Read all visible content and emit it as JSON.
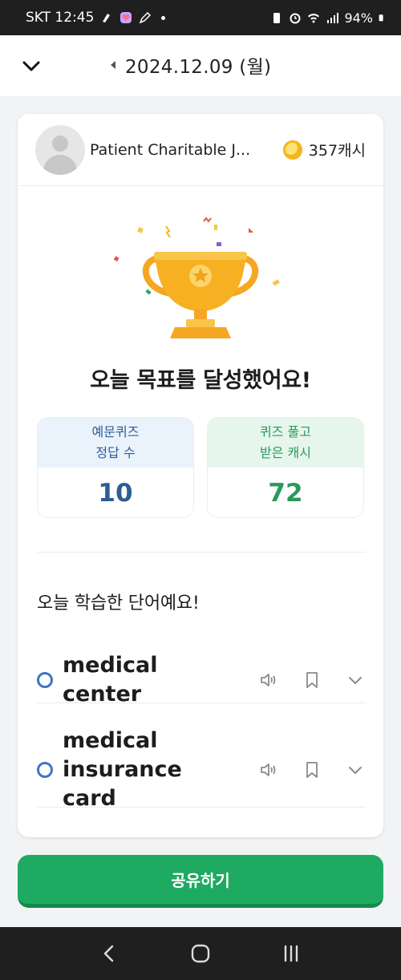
{
  "status_bar": {
    "carrier_time": "SKT 12:45",
    "battery": "94%"
  },
  "header": {
    "date": "2024.12.09 (월)"
  },
  "profile": {
    "name": "Patient Charitable J...",
    "cash": "357캐시"
  },
  "result": {
    "headline": "오늘 목표를 달성했어요!"
  },
  "stats": {
    "quiz_label_1": "예문퀴즈",
    "quiz_label_2": "정답 수",
    "quiz_value": "10",
    "cash_label_1": "퀴즈 풀고",
    "cash_label_2": "받은 캐시",
    "cash_value": "72"
  },
  "words_section": {
    "title": "오늘 학습한 단어예요!",
    "words": [
      {
        "text": "medical center"
      },
      {
        "text": "medical insurance card"
      }
    ]
  },
  "footer": {
    "share_label": "공유하기"
  },
  "colors": {
    "accent_green": "#1faa62",
    "stat_blue": "#2d5d93",
    "stat_green": "#2a9a5b",
    "ring_blue": "#3b78c2"
  },
  "icons": {
    "back": "chevron-down-icon",
    "prev_date": "triangle-left-icon",
    "speaker": "speaker-icon",
    "bookmark": "bookmark-icon",
    "expand": "chevron-down-icon"
  }
}
